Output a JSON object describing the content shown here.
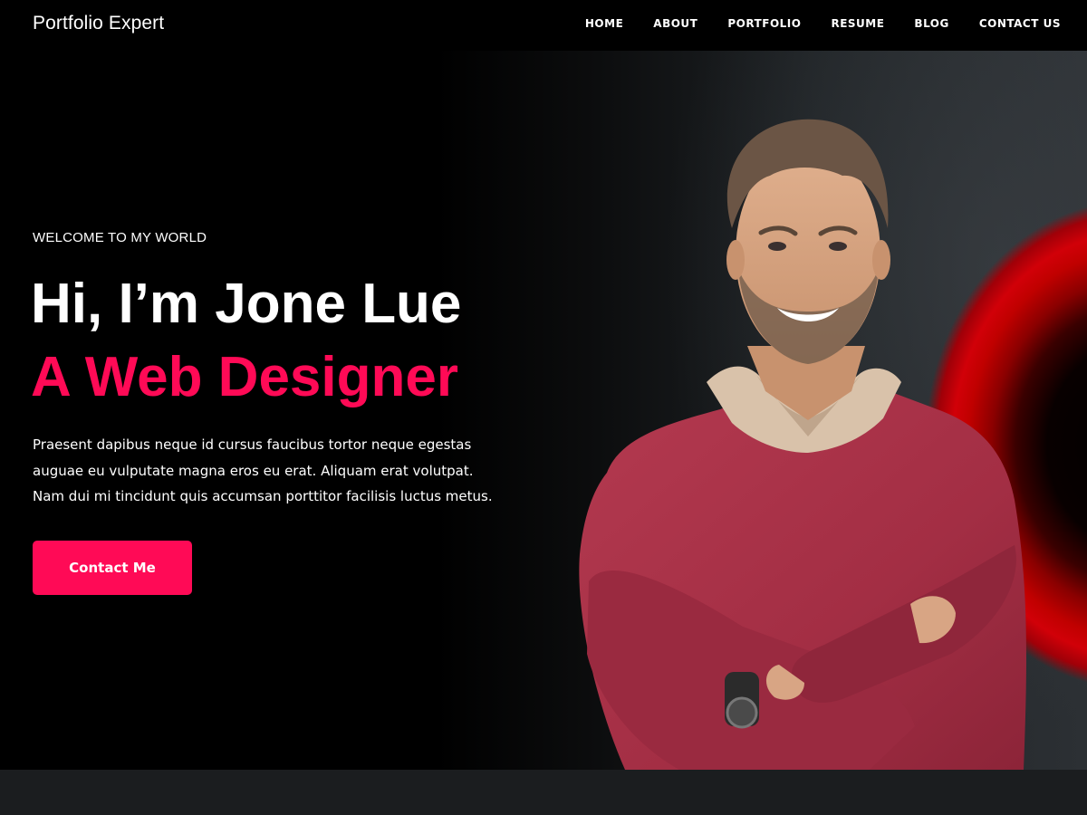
{
  "header": {
    "logo": "Portfolio Expert",
    "nav": [
      {
        "label": "HOME"
      },
      {
        "label": "ABOUT"
      },
      {
        "label": "PORTFOLIO"
      },
      {
        "label": "RESUME"
      },
      {
        "label": "BLOG"
      },
      {
        "label": "CONTACT US"
      }
    ]
  },
  "hero": {
    "welcome": "WELCOME TO MY WORLD",
    "headline": "Hi, I’m Jone Lue",
    "subheadline": "A Web Designer",
    "description": [
      "Praesent dapibus neque id cursus faucibus tortor neque egestas",
      "auguae eu vulputate magna eros eu erat. Aliquam erat volutpat.",
      "Nam dui mi tincidunt quis accumsan porttitor facilisis luctus metus."
    ],
    "cta_label": "Contact Me"
  },
  "colors": {
    "accent": "#ff0a56",
    "background": "#000000",
    "ring": "#d10008",
    "sweater": "#a83247"
  }
}
